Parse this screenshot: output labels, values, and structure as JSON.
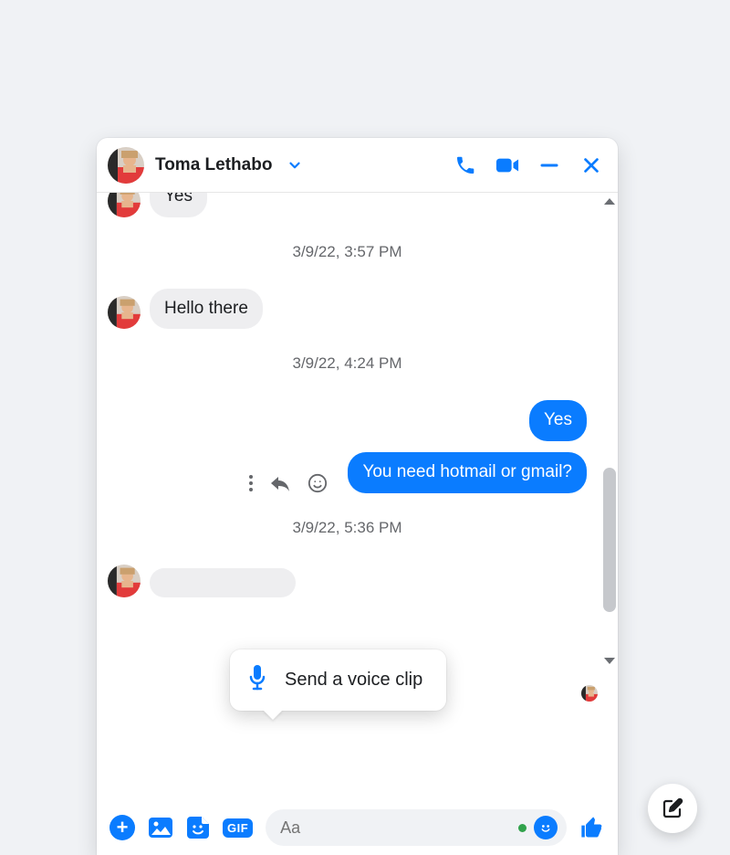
{
  "colors": {
    "accent": "#0a7cff",
    "bg": "#f0f2f5"
  },
  "header": {
    "contact_name": "Toma Lethabo"
  },
  "timestamps": {
    "t1": "3/9/22, 3:57 PM",
    "t2": "3/9/22, 4:24 PM",
    "t3": "3/9/22, 5:36 PM"
  },
  "messages": {
    "in1": "Yes",
    "in2": "Hello there",
    "out1": "Yes",
    "out2": "You need hotmail or gmail?"
  },
  "tooltip": {
    "label": "Send a voice clip"
  },
  "composer": {
    "placeholder": "Aa",
    "gif_label": "GIF"
  }
}
